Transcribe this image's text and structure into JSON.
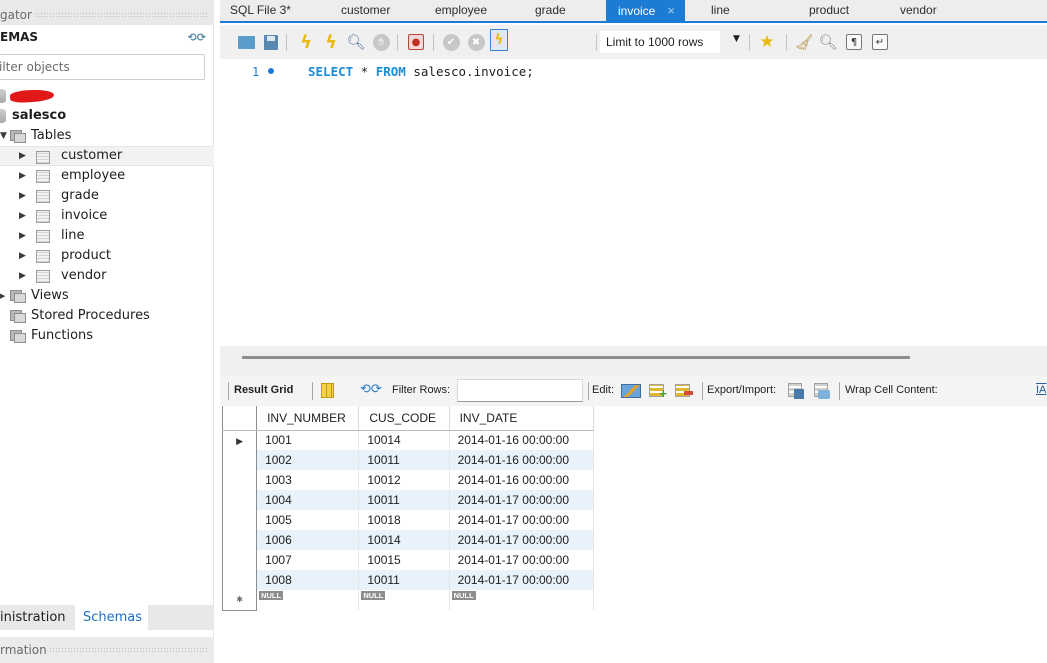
{
  "navigator": {
    "header_label": "gator",
    "schemas_title": "EMAS",
    "filter_placeholder": "ilter objects",
    "redacted_schema": "",
    "schema": {
      "name": "salesco",
      "tables_label": "Tables",
      "tables": [
        "customer",
        "employee",
        "grade",
        "invoice",
        "line",
        "product",
        "vendor"
      ],
      "views_label": "Views",
      "procedures_label": "Stored Procedures",
      "functions_label": "Functions"
    },
    "bottom_tabs": [
      {
        "label": "inistration",
        "active": false
      },
      {
        "label": "Schemas",
        "active": true
      }
    ],
    "info_header_label": "rmation"
  },
  "tabs": [
    {
      "label": "SQL File 3*",
      "active": false
    },
    {
      "label": "customer",
      "active": false
    },
    {
      "label": "employee",
      "active": false
    },
    {
      "label": "grade",
      "active": false
    },
    {
      "label": "invoice",
      "active": true
    },
    {
      "label": "line",
      "active": false
    },
    {
      "label": "product",
      "active": false
    },
    {
      "label": "vendor",
      "active": false
    }
  ],
  "tab_close_glyph": "×",
  "toolbar": {
    "limit_rows": "Limit to 1000 rows"
  },
  "editor": {
    "line_number": "1",
    "kw_select": "SELECT",
    "star": " * ",
    "kw_from": "FROM",
    "rest": " salesco.invoice;"
  },
  "result_toolbar": {
    "result_grid_label": "Result Grid",
    "filter_rows_label": "Filter Rows:",
    "filter_rows_value": "",
    "edit_label": "Edit:",
    "export_import_label": "Export/Import:",
    "wrap_label": "Wrap Cell Content:",
    "wrap_icon_glyph": "IA"
  },
  "grid": {
    "columns": [
      "INV_NUMBER",
      "CUS_CODE",
      "INV_DATE"
    ],
    "rows": [
      [
        "1001",
        "10014",
        "2014-01-16 00:00:00"
      ],
      [
        "1002",
        "10011",
        "2014-01-16 00:00:00"
      ],
      [
        "1003",
        "10012",
        "2014-01-16 00:00:00"
      ],
      [
        "1004",
        "10011",
        "2014-01-17 00:00:00"
      ],
      [
        "1005",
        "10018",
        "2014-01-17 00:00:00"
      ],
      [
        "1006",
        "10014",
        "2014-01-17 00:00:00"
      ],
      [
        "1007",
        "10015",
        "2014-01-17 00:00:00"
      ],
      [
        "1008",
        "10011",
        "2014-01-17 00:00:00"
      ]
    ],
    "null_label": "NULL",
    "current_row_glyph": "▶",
    "new_row_glyph": "✱"
  }
}
